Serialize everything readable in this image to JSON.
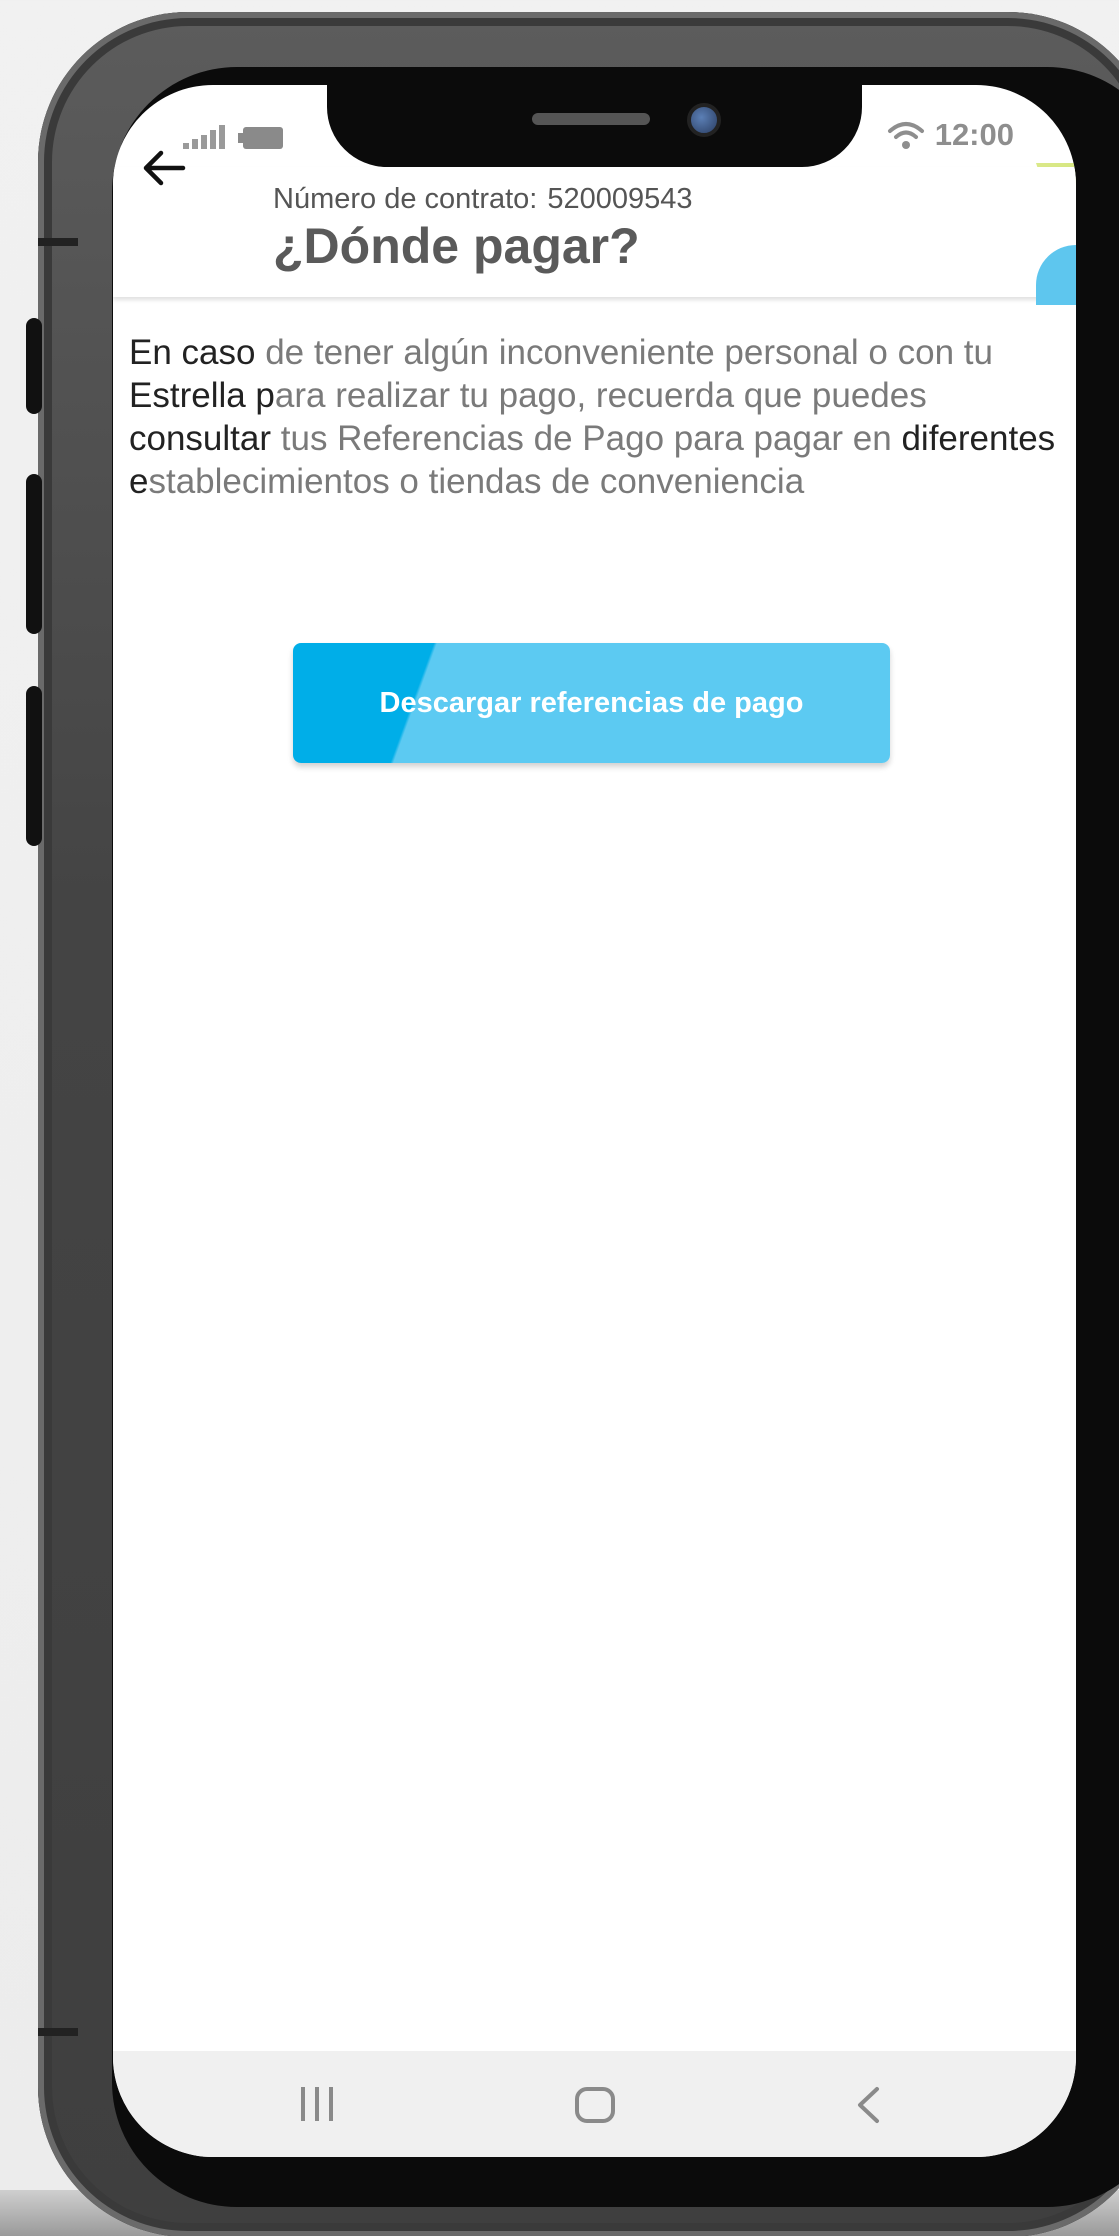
{
  "status_bar": {
    "time": "12:00"
  },
  "header": {
    "contract_label": "Número de contrato:",
    "contract_number": "520009543",
    "title": "¿Dónde pagar?"
  },
  "info": {
    "segments": [
      {
        "text": "En caso",
        "emphasis": true
      },
      {
        "text": " de tener algún inconveniente personal o con tu ",
        "emphasis": false
      },
      {
        "text": "Estrella p",
        "emphasis": true
      },
      {
        "text": "ara realizar tu pago, recuerda que puedes ",
        "emphasis": false
      },
      {
        "text": "consultar",
        "emphasis": true
      },
      {
        "text": " tus Referencias de Pago para pagar en ",
        "emphasis": false
      },
      {
        "text": "diferentes e",
        "emphasis": true
      },
      {
        "text": "stablecimientos o tiendas de conveniencia",
        "emphasis": false
      }
    ]
  },
  "actions": {
    "download_label": "Descargar referencias de pago"
  },
  "colors": {
    "button_primary": "#00aee8",
    "button_light": "#5ccaf2",
    "accent_green": "#c9e06a",
    "accent_blue": "#5ec6ee"
  },
  "icons": {
    "back": "arrow-left-icon",
    "wifi": "wifi-icon",
    "signal": "signal-icon",
    "battery": "battery-icon",
    "nav_recent": "recent-apps-icon",
    "nav_home": "home-icon",
    "nav_back": "chevron-left-icon"
  }
}
